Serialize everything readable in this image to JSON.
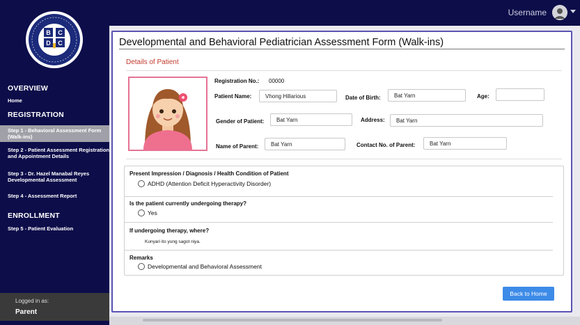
{
  "sidebar": {
    "logo_text": "BCDC",
    "overview_head": "OVERVIEW",
    "home": "Home",
    "registration_head": "REGISTRATION",
    "step1": "Step 1 - Behavioral Assessment Form (Walk-ins)",
    "step2": "Step 2 - Patient Assessment Registration and Appointment Details",
    "step3": "Step 3 - Dr. Hazel Manabal Reyes Developmental Assessment",
    "step4": "Step 4 - Assessment Report",
    "enrollment_head": "ENROLLMENT",
    "step5": "Step 5 - Patient Evaluation",
    "logged_label": "Logged in as:",
    "logged_role": "Parent"
  },
  "topbar": {
    "username": "Username"
  },
  "form": {
    "title": "Developmental and Behavioral Pediatrician Assessment Form (Walk-ins)",
    "section_title": "Details of Patient",
    "reg_label": "Registration No.:",
    "reg_value": "00000",
    "patient_name_label": "Patient Name:",
    "patient_name_value": "Vhong Hillarious",
    "dob_label": "Date of Birth:",
    "dob_value": "Bat Yarn",
    "age_label": "Age:",
    "age_value": "",
    "gender_label": "Gender of Patient:",
    "gender_value": "Bat Yarn",
    "address_label": "Address:",
    "address_value": "Bat Yarn",
    "parent_label": "Name of Parent:",
    "parent_value": "Bat Yarn",
    "contact_label": "Contact No. of Parent:",
    "contact_value": "Bat Yarn"
  },
  "questions": {
    "q1_label": "Present Impression / Diagnosis / Health Condition of Patient",
    "q1_option": "ADHD (Attention Deficit Hyperactivity Disorder)",
    "q2_label": "Is the patient currently undergoing therapy?",
    "q2_option": "Yes",
    "q3_label": "If undergoing therapy, where?",
    "q3_answer": "Kunyari ito yung sagot niya.",
    "q4_label": "Remarks",
    "q4_option": "Developmental and Behavioral Assessment"
  },
  "buttons": {
    "back_home": "Back to Home"
  },
  "colors": {
    "sidebar_bg": "#0d0d4a",
    "active_item": "#a0a0a8",
    "accent_border": "#5b53b3",
    "section_title": "#c0392b",
    "button": "#3d8be8"
  }
}
